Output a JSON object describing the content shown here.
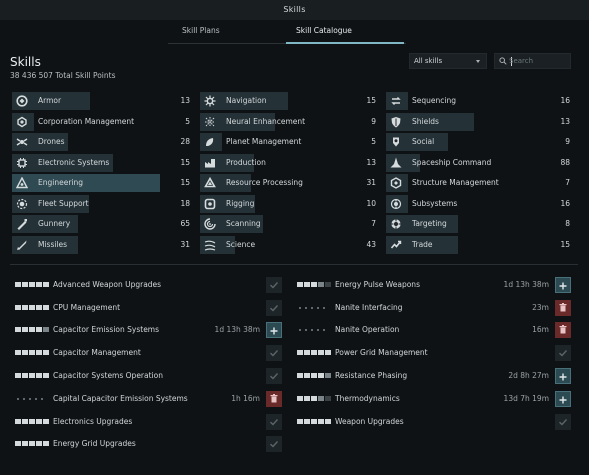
{
  "window": {
    "title": "Skills"
  },
  "tabs": [
    {
      "label": "Skill Plans",
      "active": false
    },
    {
      "label": "Skill Catalogue",
      "active": true
    }
  ],
  "header": {
    "heading": "Skills",
    "total_points": "38 436 507 Total Skill Points"
  },
  "filter": {
    "selected": "All skills"
  },
  "search": {
    "placeholder": "Search"
  },
  "colors": {
    "accent": "#7fb7c4",
    "selected_bar": "#2f4a52",
    "bar": "#243238",
    "remove": "#6a2a2a"
  },
  "categories": [
    {
      "name": "Armor",
      "count": "13",
      "icon": "armor-icon",
      "fill": 0.51,
      "selected": false
    },
    {
      "name": "Corporation Management",
      "count": "5",
      "icon": "corporation-icon",
      "fill": 0.0,
      "selected": false
    },
    {
      "name": "Drones",
      "count": "28",
      "icon": "drone-icon",
      "fill": 0.31,
      "selected": false
    },
    {
      "name": "Electronic Systems",
      "count": "15",
      "icon": "electronics-icon",
      "fill": 0.72,
      "selected": false
    },
    {
      "name": "Engineering",
      "count": "15",
      "icon": "engineering-icon",
      "fill": 0.72,
      "selected": true
    },
    {
      "name": "Fleet Support",
      "count": "18",
      "icon": "fleet-icon",
      "fill": 0.5,
      "selected": false
    },
    {
      "name": "Gunnery",
      "count": "65",
      "icon": "gunnery-icon",
      "fill": 0.4,
      "selected": false
    },
    {
      "name": "Missiles",
      "count": "31",
      "icon": "missile-icon",
      "fill": 0.4,
      "selected": false
    },
    {
      "name": "Navigation",
      "count": "15",
      "icon": "navigation-icon",
      "fill": 0.66,
      "selected": false
    },
    {
      "name": "Neural Enhancement",
      "count": "9",
      "icon": "neural-icon",
      "fill": 0.53,
      "selected": false
    },
    {
      "name": "Planet Management",
      "count": "5",
      "icon": "planet-icon",
      "fill": 0.0,
      "selected": false
    },
    {
      "name": "Production",
      "count": "13",
      "icon": "production-icon",
      "fill": 0.32,
      "selected": false
    },
    {
      "name": "Resource Processing",
      "count": "31",
      "icon": "resource-icon",
      "fill": 0.29,
      "selected": false
    },
    {
      "name": "Rigging",
      "count": "10",
      "icon": "rigging-icon",
      "fill": 0.33,
      "selected": false
    },
    {
      "name": "Scanning",
      "count": "7",
      "icon": "scanning-icon",
      "fill": 0.41,
      "selected": false
    },
    {
      "name": "Science",
      "count": "43",
      "icon": "science-icon",
      "fill": 0.13,
      "selected": false
    },
    {
      "name": "Sequencing",
      "count": "16",
      "icon": "sequencing-icon",
      "fill": 0.0,
      "selected": false
    },
    {
      "name": "Shields",
      "count": "13",
      "icon": "shield-icon",
      "fill": 0.66,
      "selected": false
    },
    {
      "name": "Social",
      "count": "9",
      "icon": "social-icon",
      "fill": 0.4,
      "selected": false
    },
    {
      "name": "Spaceship Command",
      "count": "88",
      "icon": "spaceship-icon",
      "fill": 0.12,
      "selected": false
    },
    {
      "name": "Structure Management",
      "count": "7",
      "icon": "structure-icon",
      "fill": 0.0,
      "selected": false
    },
    {
      "name": "Subsystems",
      "count": "16",
      "icon": "subsystem-icon",
      "fill": 0.0,
      "selected": false
    },
    {
      "name": "Targeting",
      "count": "8",
      "icon": "targeting-icon",
      "fill": 0.5,
      "selected": false
    },
    {
      "name": "Trade",
      "count": "15",
      "icon": "trade-icon",
      "fill": 0.5,
      "selected": false
    }
  ],
  "skills_left": [
    {
      "name": "Advanced Weapon Upgrades",
      "level": 5,
      "time": "",
      "action": "trained"
    },
    {
      "name": "CPU Management",
      "level": 5,
      "time": "",
      "action": "trained"
    },
    {
      "name": "Capacitor Emission Systems",
      "level": 4,
      "time": "1d 13h 38m",
      "action": "add"
    },
    {
      "name": "Capacitor Management",
      "level": 5,
      "time": "",
      "action": "trained"
    },
    {
      "name": "Capacitor Systems Operation",
      "level": 5,
      "time": "",
      "action": "trained"
    },
    {
      "name": "Capital Capacitor Emission Systems",
      "level": 0,
      "time": "1h 16m",
      "action": "remove"
    },
    {
      "name": "Electronics Upgrades",
      "level": 5,
      "time": "",
      "action": "trained"
    },
    {
      "name": "Energy Grid Upgrades",
      "level": 5,
      "time": "",
      "action": "trained"
    }
  ],
  "skills_right": [
    {
      "name": "Energy Pulse Weapons",
      "level": 3,
      "time": "1d 13h 38m",
      "action": "add"
    },
    {
      "name": "Nanite Interfacing",
      "level": 0,
      "time": "23m",
      "action": "remove"
    },
    {
      "name": "Nanite Operation",
      "level": 0,
      "time": "16m",
      "action": "remove"
    },
    {
      "name": "Power Grid Management",
      "level": 5,
      "time": "",
      "action": "trained"
    },
    {
      "name": "Resistance Phasing",
      "level": 4,
      "time": "2d 8h 27m",
      "action": "add"
    },
    {
      "name": "Thermodynamics",
      "level": 3,
      "time": "13d 7h 19m",
      "action": "add"
    },
    {
      "name": "Weapon Upgrades",
      "level": 5,
      "time": "",
      "action": "trained"
    }
  ]
}
